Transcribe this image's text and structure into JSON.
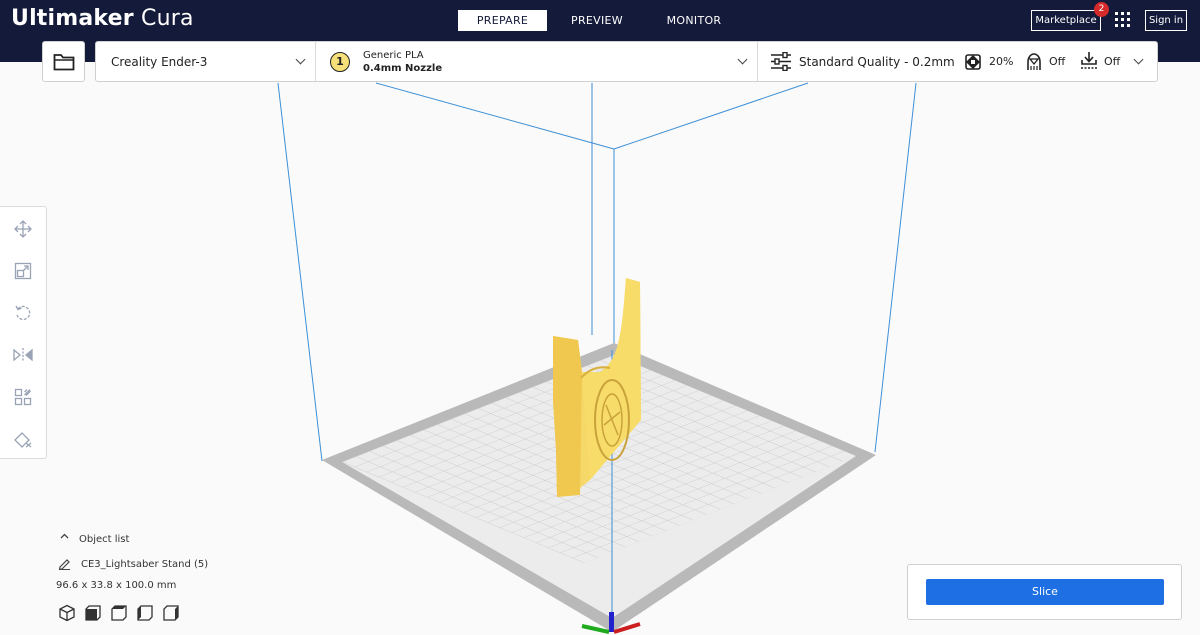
{
  "header": {
    "app_title_bold": "Ultimaker",
    "app_title_light": "Cura",
    "tabs": [
      {
        "label": "PREPARE",
        "active": true
      },
      {
        "label": "PREVIEW",
        "active": false
      },
      {
        "label": "MONITOR",
        "active": false
      }
    ],
    "marketplace_label": "Marketplace",
    "marketplace_badge": "2",
    "signin_label": "Sign in"
  },
  "toolbar": {
    "printer": "Creality Ender-3",
    "extruder_number": "1",
    "material": "Generic PLA",
    "nozzle": "0.4mm Nozzle",
    "quality": "Standard Quality - 0.2mm",
    "infill": "20%",
    "support": "Off",
    "adhesion": "Off"
  },
  "tools": [
    "move-icon",
    "scale-icon",
    "rotate-icon",
    "mirror-icon",
    "per-model-settings-icon",
    "support-blocker-icon"
  ],
  "object_list": {
    "label": "Object list",
    "object_name": "CE3_Lightsaber Stand (5)",
    "dimensions": "96.6 x 33.8 x 100.0 mm"
  },
  "slice": {
    "button_label": "Slice"
  },
  "colors": {
    "header_bg": "#141a3a",
    "accent_blue": "#1e6fe3",
    "model_yellow": "#f5d867",
    "build_volume_line": "#3c8fd6",
    "badge_red": "#d42a2a"
  }
}
